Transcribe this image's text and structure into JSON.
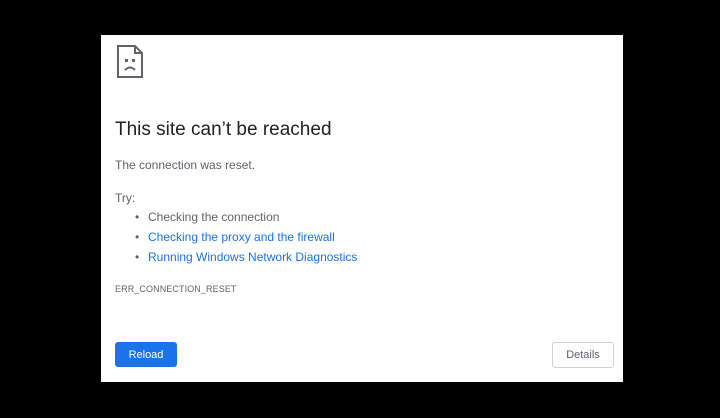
{
  "icon": "sad-page-icon",
  "title": "This site can’t be reached",
  "summary": "The connection was reset.",
  "try_label": "Try:",
  "suggestions": [
    {
      "text": "Checking the connection",
      "link": false
    },
    {
      "text": "Checking the proxy and the firewall",
      "link": true
    },
    {
      "text": "Running Windows Network Diagnostics",
      "link": true
    }
  ],
  "error_code": "ERR_CONNECTION_RESET",
  "buttons": {
    "reload": "Reload",
    "details": "Details"
  },
  "colors": {
    "frame": "#000000",
    "page_background": "#ffffff",
    "heading": "#202124",
    "secondary_text": "#5f6368",
    "link": "#1a73e8",
    "primary_button": "#1a73e8"
  }
}
